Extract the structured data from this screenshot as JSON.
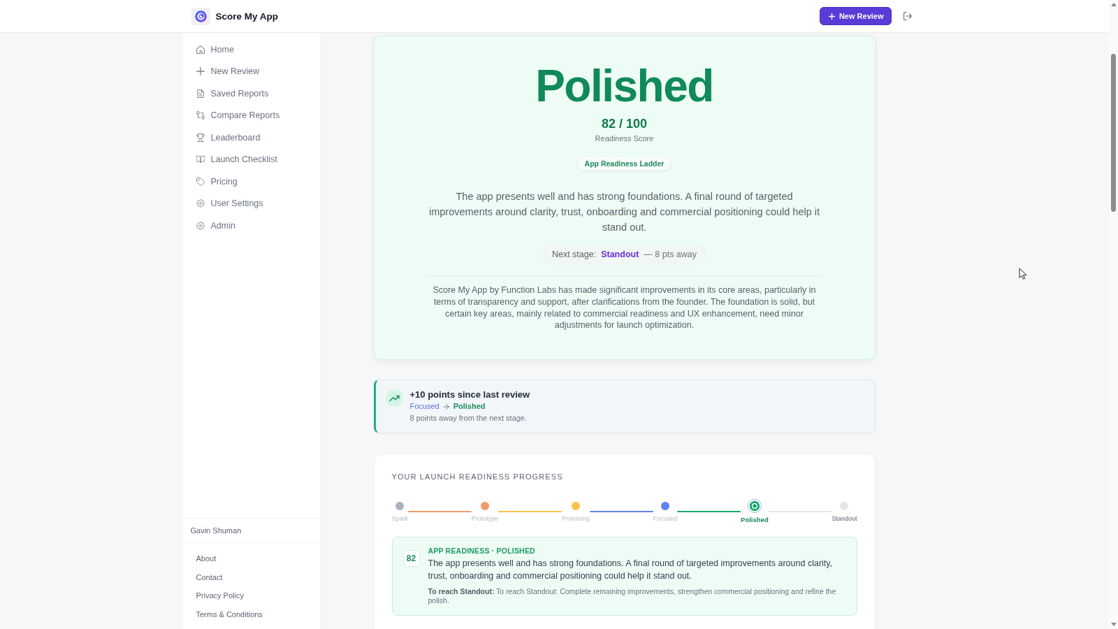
{
  "header": {
    "app_name": "Score My App",
    "new_review_button": "New Review"
  },
  "sidebar": {
    "items": [
      {
        "label": "Home"
      },
      {
        "label": "New Review"
      },
      {
        "label": "Saved Reports"
      },
      {
        "label": "Compare Reports"
      },
      {
        "label": "Leaderboard"
      },
      {
        "label": "Launch Checklist"
      },
      {
        "label": "Pricing"
      },
      {
        "label": "User Settings"
      },
      {
        "label": "Admin"
      }
    ],
    "user_name": "Gavin Shuman",
    "footer_links": [
      "About",
      "Contact",
      "Privacy Policy",
      "Terms & Conditions"
    ]
  },
  "hero": {
    "stage": "Polished",
    "score": "82 / 100",
    "score_label": "Readiness Score",
    "ladder_badge": "App Readiness Ladder",
    "description": "The app presents well and has strong foundations. A final round of targeted improvements around clarity, trust, onboarding and commercial positioning could help it stand out.",
    "next_stage": {
      "label": "Next stage:",
      "stage": "Standout",
      "distance": "— 8 pts away"
    },
    "summary": "Score My App by Function Labs has made significant improvements in its core areas, particularly in terms of transparency and support, after clarifications from the founder. The foundation is solid, but certain key areas, mainly related to commercial readiness and UX enhancement, need minor adjustments for launch optimization."
  },
  "change_card": {
    "title": "+10 points since last review",
    "from_stage": "Focused",
    "to_stage": "Polished",
    "note": "8 points away from the next stage."
  },
  "progress": {
    "title": "YOUR LAUNCH READINESS PROGRESS",
    "stages": [
      {
        "label": "Spark",
        "color": "#aab2bf",
        "completed": true,
        "selected": false
      },
      {
        "label": "Prototype",
        "color": "#f4996a",
        "completed": true,
        "selected": false
      },
      {
        "label": "Promising",
        "color": "#f7c54d",
        "completed": true,
        "selected": false
      },
      {
        "label": "Focused",
        "color": "#5f83ec",
        "completed": true,
        "selected": false
      },
      {
        "label": "Polished",
        "color": "#1aa86c",
        "completed": false,
        "selected": true
      },
      {
        "label": "Standout",
        "color": "#e3e6ea",
        "completed": false,
        "selected": false
      }
    ],
    "detail": {
      "score": "82",
      "title": "APP READINESS · POLISHED",
      "description": "The app presents well and has strong foundations. A final round of targeted improvements around clarity, trust, onboarding and commercial positioning could help it stand out.",
      "next_step": "**To reach Standout:** To reach Standout: Complete remaining improvements, strengthen commercial positioning and refine the polish."
    }
  }
}
